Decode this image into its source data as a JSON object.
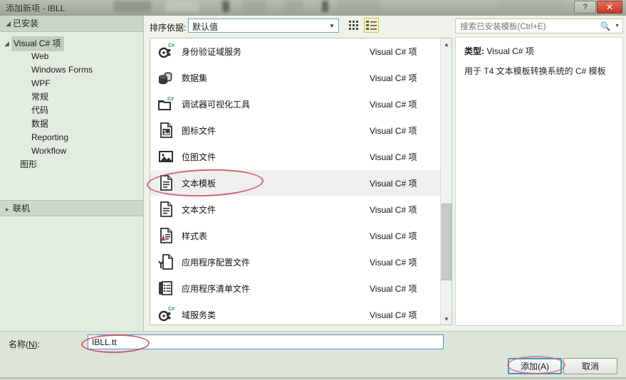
{
  "window": {
    "title": "添加新项 - IBLL",
    "help_label": "?",
    "close_label": "✕"
  },
  "sidebar": {
    "header": "已安装",
    "tree": [
      {
        "label": "Visual C# 项",
        "level": 1,
        "expanded": true,
        "selected": true
      },
      {
        "label": "Web",
        "level": 2
      },
      {
        "label": "Windows Forms",
        "level": 2
      },
      {
        "label": "WPF",
        "level": 2
      },
      {
        "label": "常规",
        "level": 2
      },
      {
        "label": "代码",
        "level": 2
      },
      {
        "label": "数据",
        "level": 2
      },
      {
        "label": "Reporting",
        "level": 2
      },
      {
        "label": "Workflow",
        "level": 2
      },
      {
        "label": "图形",
        "level": 1.5
      }
    ],
    "online": "联机"
  },
  "toolbar": {
    "sort_label": "排序依据:",
    "sort_value": "默认值",
    "grid_view_icon": "grid-view-icon",
    "list_view_icon": "list-view-icon"
  },
  "list": {
    "type_column": "Visual C# 项",
    "items": [
      {
        "name": "身份验证域服务",
        "type": "Visual C# 项",
        "icon": "domain-service-csharp-icon",
        "selected": false
      },
      {
        "name": "数据集",
        "type": "Visual C# 项",
        "icon": "dataset-icon",
        "selected": false
      },
      {
        "name": "调试器可视化工具",
        "type": "Visual C# 项",
        "icon": "debugger-visualizer-csharp-icon",
        "selected": false
      },
      {
        "name": "图标文件",
        "type": "Visual C# 项",
        "icon": "icon-file-icon",
        "selected": false
      },
      {
        "name": "位图文件",
        "type": "Visual C# 项",
        "icon": "bitmap-file-icon",
        "selected": false
      },
      {
        "name": "文本模板",
        "type": "Visual C# 项",
        "icon": "text-template-icon",
        "selected": true
      },
      {
        "name": "文本文件",
        "type": "Visual C# 项",
        "icon": "text-file-icon",
        "selected": false
      },
      {
        "name": "样式表",
        "type": "Visual C# 项",
        "icon": "stylesheet-icon",
        "selected": false
      },
      {
        "name": "应用程序配置文件",
        "type": "Visual C# 项",
        "icon": "app-config-file-icon",
        "selected": false
      },
      {
        "name": "应用程序清单文件",
        "type": "Visual C# 项",
        "icon": "app-manifest-file-icon",
        "selected": false
      },
      {
        "name": "域服务类",
        "type": "Visual C# 项",
        "icon": "domain-service-class-icon",
        "selected": false
      }
    ]
  },
  "search": {
    "placeholder": "搜索已安装模板(Ctrl+E)",
    "value": ""
  },
  "details": {
    "type_label": "类型:",
    "type_value": "Visual C# 项",
    "description": "用于 T4 文本模板转换系统的 C# 模板"
  },
  "footer": {
    "name_label_prefix": "名称(",
    "name_label_key": "N",
    "name_label_suffix": "):",
    "name_value": "IBLL.tt",
    "add_button": "添加(A)",
    "cancel_button": "取消"
  },
  "colors": {
    "window_background": "#eef2ea",
    "sidebar_background": "#e3ece0",
    "selected_row": "#efefef",
    "accent_focus": "#3a9ab5",
    "annotation_red": "#c23b52",
    "close_button": "#c33a24",
    "list_view_active": "#fdf3d2"
  }
}
